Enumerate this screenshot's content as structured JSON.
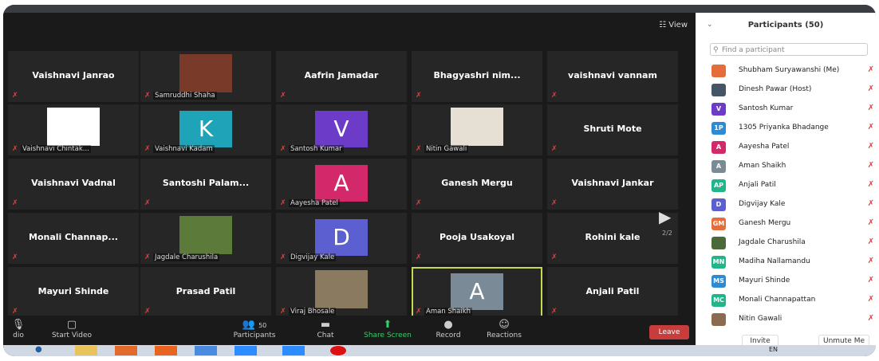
{
  "meeting": {
    "view_label": "View",
    "tiles": [
      {
        "name": "Vaishnavi Janrao",
        "label": "",
        "type": "name"
      },
      {
        "name": "",
        "label": "Samruddhi Shaha",
        "type": "photo",
        "photo_color": "#7a3a2a"
      },
      {
        "name": "Aafrin Jamadar",
        "label": "",
        "type": "name"
      },
      {
        "name": "Bhagyashri nim...",
        "label": "",
        "type": "name"
      },
      {
        "name": "vaishnavi vannam",
        "label": "",
        "type": "name"
      },
      {
        "name": "",
        "label": "Vaishnavi Chintak...",
        "type": "photo",
        "photo_color": "#ffffff"
      },
      {
        "name": "",
        "label": "Vaishnavi Kadam",
        "type": "avatar",
        "initial": "K",
        "color": "#1ea3b8"
      },
      {
        "name": "",
        "label": "Santosh Kumar",
        "type": "avatar",
        "initial": "V",
        "color": "#6c3cc8"
      },
      {
        "name": "",
        "label": "Nitin Gawali",
        "type": "photo",
        "photo_color": "#e6e0d4"
      },
      {
        "name": "Shruti Mote",
        "label": "",
        "type": "name"
      },
      {
        "name": "Vaishnavi Vadnal",
        "label": "",
        "type": "name"
      },
      {
        "name": "Santoshi Palam...",
        "label": "",
        "type": "name"
      },
      {
        "name": "",
        "label": "Aayesha Patel",
        "type": "avatar",
        "initial": "A",
        "color": "#d3286a"
      },
      {
        "name": "Ganesh Mergu",
        "label": "",
        "type": "name"
      },
      {
        "name": "Vaishnavi Jankar",
        "label": "",
        "type": "name"
      },
      {
        "name": "Monali Channap...",
        "label": "",
        "type": "name"
      },
      {
        "name": "",
        "label": "Jagdale Charushila",
        "type": "photo",
        "photo_color": "#5c7a3a"
      },
      {
        "name": "",
        "label": "Digvijay Kale",
        "type": "avatar",
        "initial": "D",
        "color": "#5b5fd0"
      },
      {
        "name": "Pooja Usakoyal",
        "label": "",
        "type": "name"
      },
      {
        "name": "Rohini kale",
        "label": "",
        "type": "name"
      },
      {
        "name": "Mayuri Shinde",
        "label": "",
        "type": "name"
      },
      {
        "name": "Prasad Patil",
        "label": "",
        "type": "name"
      },
      {
        "name": "",
        "label": "Viraj Bhosale",
        "type": "photo",
        "photo_color": "#8a7a60"
      },
      {
        "name": "",
        "label": "Aman Shaikh",
        "type": "avatar",
        "initial": "A",
        "color": "#7a8a96"
      },
      {
        "name": "Anjali Patil",
        "label": "",
        "type": "name"
      }
    ],
    "page_indicator": "2/2"
  },
  "toolbar": {
    "audio_label": "dio",
    "video_label": "Start Video",
    "participants_label": "Participants",
    "participants_count": "50",
    "chat_label": "Chat",
    "share_label": "Share Screen",
    "record_label": "Record",
    "reactions_label": "Reactions",
    "leave_label": "Leave"
  },
  "participants_panel": {
    "title": "Participants (50)",
    "search_placeholder": "Find a participant",
    "participants": [
      {
        "name": "Shubham Suryawanshi (Me)",
        "initials": "",
        "color": "#e46d3a"
      },
      {
        "name": "Dinesh Pawar (Host)",
        "initials": "",
        "color": "#445566"
      },
      {
        "name": "Santosh Kumar",
        "initials": "V",
        "color": "#6c3cc8"
      },
      {
        "name": "1305 Priyanka Bhadange",
        "initials": "1P",
        "color": "#2d8bd6"
      },
      {
        "name": "Aayesha Patel",
        "initials": "A",
        "color": "#d3286a"
      },
      {
        "name": "Aman Shaikh",
        "initials": "A",
        "color": "#7a8a96"
      },
      {
        "name": "Anjali Patil",
        "initials": "AP",
        "color": "#20b58a"
      },
      {
        "name": "Digvijay Kale",
        "initials": "D",
        "color": "#5b5fd0"
      },
      {
        "name": "Ganesh Mergu",
        "initials": "GM",
        "color": "#e46d3a"
      },
      {
        "name": "Jagdale Charushila",
        "initials": "",
        "color": "#4a6a3a"
      },
      {
        "name": "Madiha Nallamandu",
        "initials": "MN",
        "color": "#20b58a"
      },
      {
        "name": "Mayuri Shinde",
        "initials": "MS",
        "color": "#2d8bd6"
      },
      {
        "name": "Monali Channapattan",
        "initials": "MC",
        "color": "#20b58a"
      },
      {
        "name": "Nitin Gawali",
        "initials": "",
        "color": "#8a6a50"
      }
    ],
    "invite_label": "Invite",
    "unmute_label": "Unmute Me"
  },
  "taskbar": {
    "lang": "EN"
  }
}
